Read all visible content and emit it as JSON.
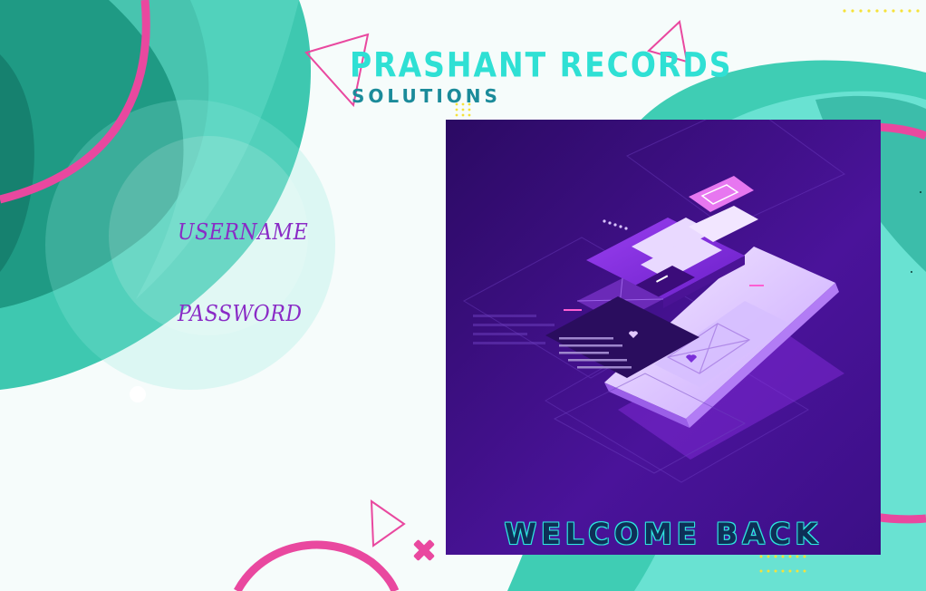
{
  "brand": {
    "title": "PRASHANT RECORDS",
    "subtitle": "SOLUTIONS"
  },
  "login": {
    "username_label": "USERNAME",
    "username_value": "",
    "password_label": "PASSWORD",
    "password_value": ""
  },
  "hero": {
    "welcome_text": "WELCOME BACK",
    "illustration": "isometric-phone-login-illustration"
  },
  "colors": {
    "teal_dark": "#1e9b83",
    "teal_mid": "#3cc9b0",
    "teal_light": "#7fe7d8",
    "pink": "#e9489f",
    "purple_label": "#8a2bc6",
    "brand_cyan": "#2fe0d4",
    "brand_sub": "#1b8b9a",
    "hero_bg": "#3a0f7a",
    "dots_yellow": "#f5e23a"
  }
}
